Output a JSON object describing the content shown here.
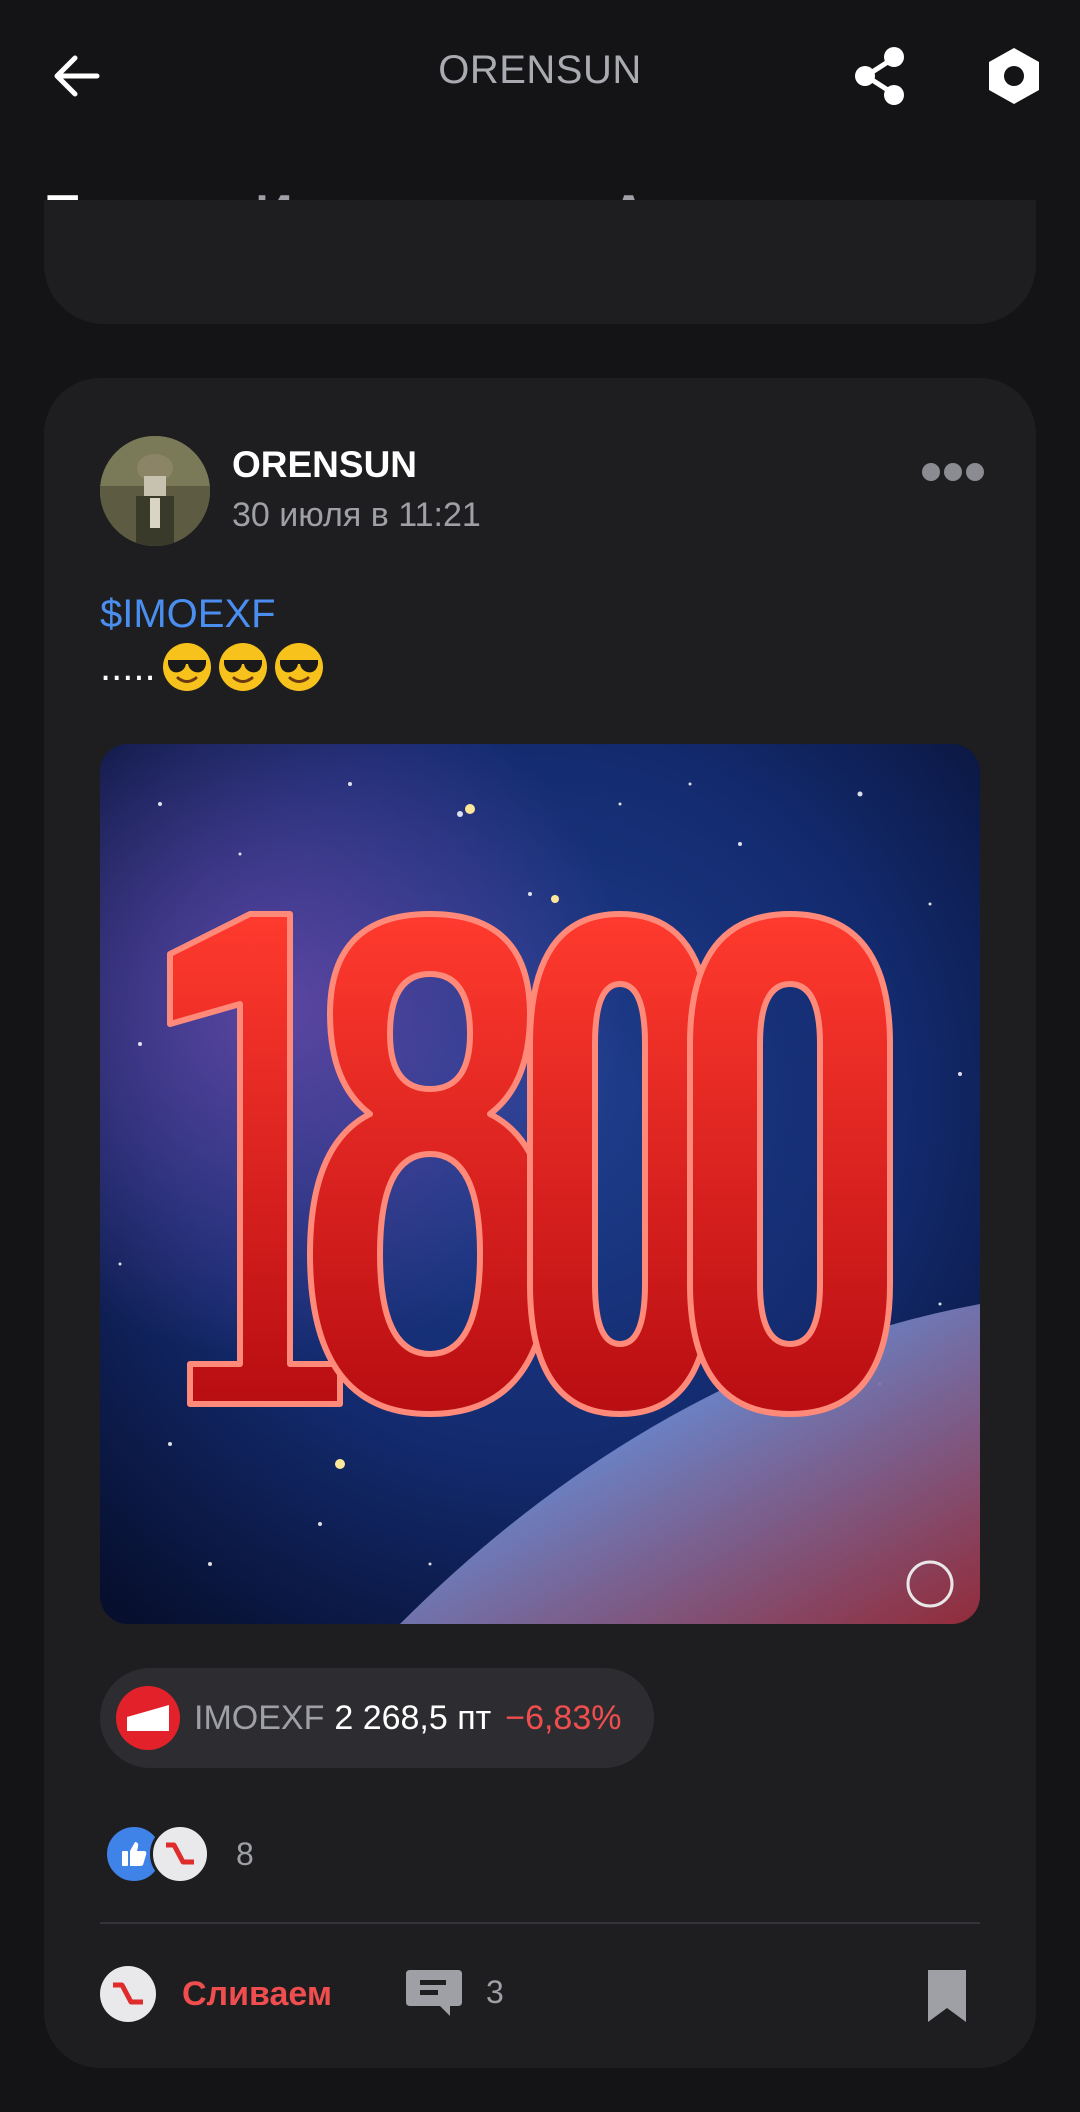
{
  "header": {
    "title": "ORENSUN",
    "back_icon": "arrow-left-icon",
    "share_icon": "share-icon",
    "settings_icon": "hexagon-settings-icon"
  },
  "tabs": [
    {
      "label": "Посты",
      "active": true
    },
    {
      "label": "Инвестиции",
      "active": false
    },
    {
      "label": "Активности",
      "active": false
    }
  ],
  "post": {
    "author": "ORENSUN",
    "date": "30 июля в 11:21",
    "ticker_link": "$IMOEXF",
    "text": ".....",
    "emoji": [
      "smiling-face-with-sunglasses",
      "smiling-face-with-sunglasses",
      "smiling-face-with-sunglasses"
    ],
    "image_alt": "1800",
    "quote": {
      "ticker": "IMOEXF",
      "price": "2 268,5 пт",
      "change": "−6,83%",
      "change_color": "#f04e4e"
    },
    "reactions_count": "8",
    "sell_label": "Сливаем",
    "comments_count": "3"
  },
  "colors": {
    "background": "#141416",
    "card": "#1e1e21",
    "accent_link": "#4a8ef0",
    "negative": "#f04e4e"
  }
}
